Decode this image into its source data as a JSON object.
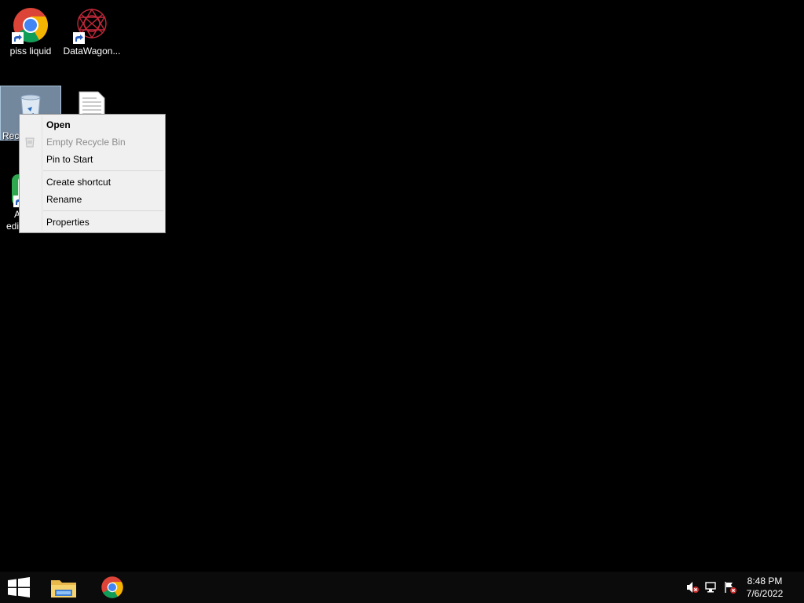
{
  "desktop": {
    "icons": [
      {
        "label": "piss liquid",
        "icon": "chrome-icon"
      },
      {
        "label": "DataWagon...",
        "icon": "datawagon-icon"
      },
      {
        "label": "Recy",
        "icon": "recycle-bin-icon"
      },
      {
        "label": "",
        "icon": "text-file-icon"
      },
      {
        "label": "A",
        "icon": "green-app-icon"
      },
      {
        "label": "edi",
        "icon": "green-app-icon"
      }
    ]
  },
  "context_menu": {
    "items": [
      {
        "label": "Open",
        "style": "default"
      },
      {
        "label": "Empty Recycle Bin",
        "style": "disabled"
      },
      {
        "label": "Pin to Start",
        "style": "normal"
      },
      {
        "label": "Create shortcut",
        "style": "normal"
      },
      {
        "label": "Rename",
        "style": "normal"
      },
      {
        "label": "Properties",
        "style": "normal"
      }
    ]
  },
  "taskbar": {
    "start_icon": "windows-logo-icon",
    "pinned": [
      "file-explorer-icon",
      "chrome-icon"
    ],
    "tray": {
      "icons": [
        "volume-muted-icon",
        "network-error-icon",
        "action-center-flag-icon"
      ],
      "time": "8:48 PM",
      "date": "7/6/2022"
    }
  },
  "colors": {
    "desktop_bg": "#000000",
    "taskbar_bg": "#0b0b0b",
    "menu_bg": "#f0f0f0",
    "selection": "#99b4d1"
  }
}
